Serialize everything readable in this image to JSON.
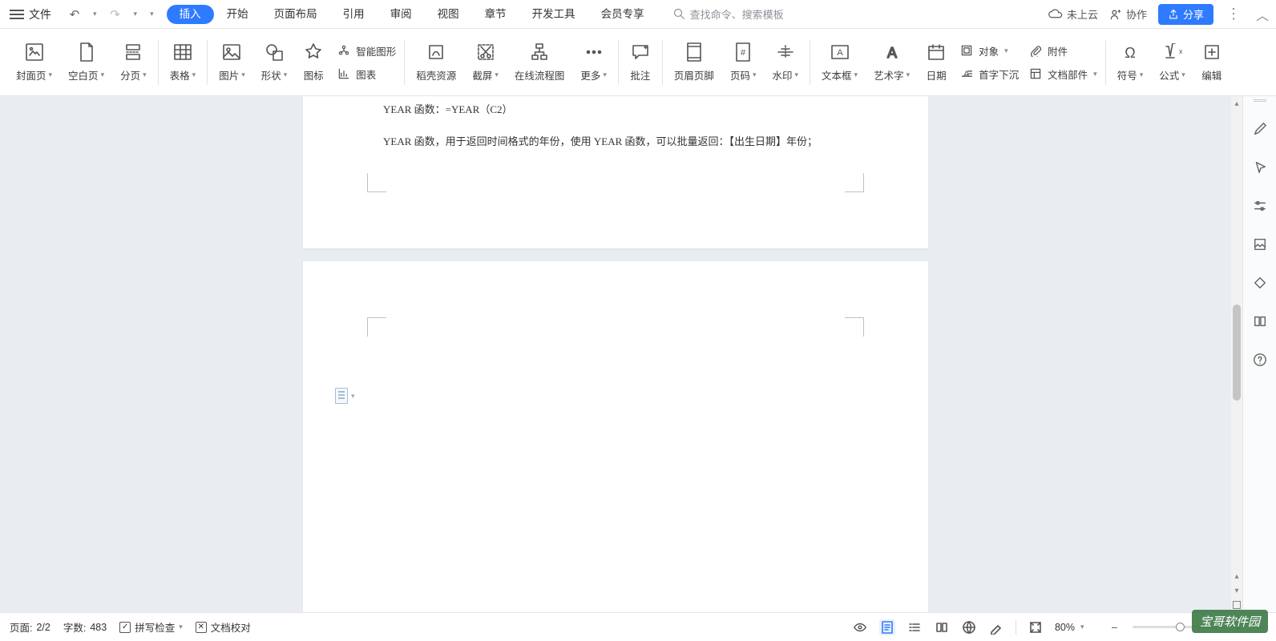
{
  "topbar": {
    "file": "文件",
    "tabs": [
      "插入",
      "开始",
      "页面布局",
      "引用",
      "审阅",
      "视图",
      "章节",
      "开发工具",
      "会员专享"
    ],
    "active_tab": 0,
    "search_placeholder": "查找命令、搜索模板",
    "cloud": "未上云",
    "collab": "协作",
    "share": "分享"
  },
  "ribbon": {
    "cover": "封面页",
    "blank": "空白页",
    "break": "分页",
    "table": "表格",
    "pic": "图片",
    "shape": "形状",
    "icon": "图标",
    "smart": "智能图形",
    "chart": "图表",
    "doke": "稻壳资源",
    "screenshot": "截屏",
    "flowchart": "在线流程图",
    "more": "更多",
    "comment": "批注",
    "headerfooter": "页眉页脚",
    "pagenum": "页码",
    "watermark": "水印",
    "textbox": "文本框",
    "wordart": "艺术字",
    "date": "日期",
    "object": "对象",
    "dropcap": "首字下沉",
    "attach": "附件",
    "docpart": "文档部件",
    "symbol": "符号",
    "formula": "公式",
    "edit": "编辑"
  },
  "doc": {
    "line1": "YEAR 函数：=YEAR（C2）",
    "line2": "YEAR 函数，用于返回时间格式的年份，使用 YEAR 函数，可以批量返回：【出生日期】年份；"
  },
  "status": {
    "page_label": "页面:",
    "page_val": "2/2",
    "words_label": "字数:",
    "words_val": "483",
    "spell": "拼写检查",
    "proof": "文档校对",
    "zoom": "80%"
  },
  "watermark": "宝哥软件园"
}
